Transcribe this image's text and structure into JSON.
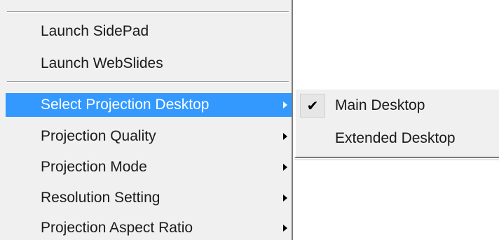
{
  "menu": {
    "top_items": [
      {
        "label": "Launch SidePad"
      },
      {
        "label": "Launch WebSlides"
      }
    ],
    "submenu_items": [
      {
        "label": "Select Projection Desktop",
        "selected": true
      },
      {
        "label": "Projection Quality",
        "selected": false
      },
      {
        "label": "Projection Mode",
        "selected": false
      },
      {
        "label": "Resolution Setting",
        "selected": false
      },
      {
        "label": "Projection Aspect Ratio",
        "selected": false
      }
    ]
  },
  "submenu": {
    "items": [
      {
        "label": "Main Desktop",
        "checked": true,
        "check_glyph": "✔"
      },
      {
        "label": "Extended Desktop",
        "checked": false
      }
    ]
  },
  "colors": {
    "menu_background": "#f0f0f0",
    "highlight": "#3399ff",
    "highlight_text": "#ffffff",
    "text": "#1a1a1a"
  },
  "icons": {
    "submenu_arrow": "chevron-right-icon",
    "check": "checkmark-icon"
  }
}
